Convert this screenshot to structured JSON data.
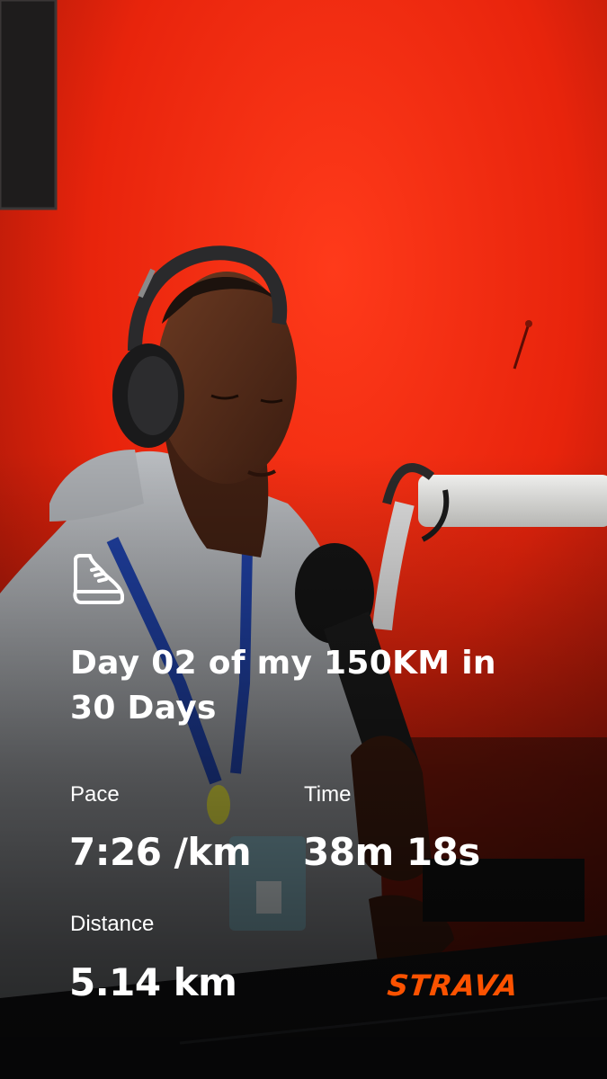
{
  "activity": {
    "icon": "running-shoe-icon",
    "title": "Day 02 of my 150KM in 30 Days"
  },
  "stats": {
    "pace": {
      "label": "Pace",
      "value": "7:26 /km"
    },
    "time": {
      "label": "Time",
      "value": "38m 18s"
    },
    "distance": {
      "label": "Distance",
      "value": "5.14 km"
    }
  },
  "brand": {
    "name": "STRAVA",
    "color": "#fc5200"
  },
  "colors": {
    "background_wall": "#e8280f",
    "text": "#ffffff"
  }
}
